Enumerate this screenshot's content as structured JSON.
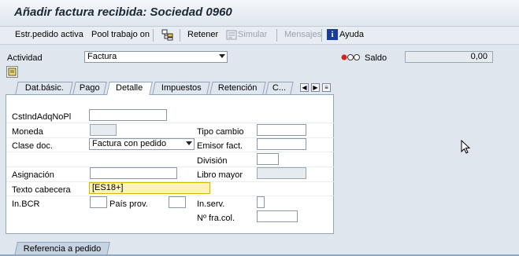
{
  "title": "Añadir factura recibida: Sociedad 0960",
  "toolbar": {
    "estr_pedido": "Estr.pedido activa",
    "pool_trabajo": "Pool trabajo on",
    "retener": "Retener",
    "simular": "Simular",
    "mensajes": "Mensajes",
    "ayuda": "Ayuda"
  },
  "header": {
    "actividad_label": "Actividad",
    "actividad_value": "Factura",
    "saldo_label": "Saldo",
    "saldo_value": "0,00"
  },
  "tabs": [
    "Dat.básic.",
    "Pago",
    "Detalle",
    "Impuestos",
    "Retención",
    "C..."
  ],
  "form": {
    "cst_label": "CstIndAdqNoPl",
    "cst_value": "",
    "moneda_label": "Moneda",
    "moneda_value": "",
    "clase_doc_label": "Clase doc.",
    "clase_doc_value": "Factura con pedido",
    "asignacion_label": "Asignación",
    "asignacion_value": "",
    "texto_cabecera_label": "Texto cabecera",
    "texto_cabecera_value": "[ES18+]",
    "in_bcr_label": "In.BCR",
    "in_bcr_value": "",
    "pais_prov_label": "País prov.",
    "pais_prov_value": "",
    "tipo_cambio_label": "Tipo cambio",
    "tipo_cambio_value": "",
    "emisor_fact_label": "Emisor fact.",
    "emisor_fact_value": "",
    "division_label": "División",
    "division_value": "",
    "libro_mayor_label": "Libro mayor",
    "libro_mayor_value": "",
    "in_serv_label": "In.serv.",
    "in_serv_value": "",
    "no_fra_col_label": "Nº fra.col.",
    "no_fra_col_value": ""
  },
  "bottom_tab": "Referencia a pedido",
  "colors": {
    "traffic_red": "#d32020",
    "active_tab_border": "#8ea7c2",
    "focus_field": "#fff3b5"
  }
}
